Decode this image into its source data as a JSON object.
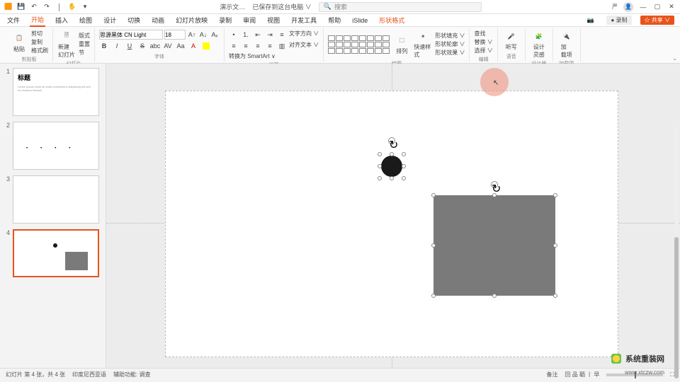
{
  "titlebar": {
    "doc_name": "演示文…",
    "autosave": "已保存到这台电脑 ∨",
    "search_placeholder": "搜索",
    "user_initial": "严"
  },
  "menu": {
    "tabs": [
      "文件",
      "开始",
      "插入",
      "绘图",
      "设计",
      "切换",
      "动画",
      "幻灯片放映",
      "录制",
      "审阅",
      "视图",
      "开发工具",
      "帮助",
      "iSlide",
      "形状格式"
    ],
    "active_index": 1,
    "record_btn": "● 录制",
    "share_btn": "☆ 共享 ∨",
    "camera_btn": "📷"
  },
  "ribbon": {
    "clipboard": {
      "paste": "粘贴",
      "cut": "剪切",
      "copy": "复制",
      "format_painter": "格式刷",
      "label": "剪贴板"
    },
    "slides": {
      "new_slide": "新建\n幻灯片",
      "layout": "版式",
      "reset": "重置",
      "section": "节",
      "label": "幻灯片"
    },
    "font": {
      "name": "思源黑体 CN Light",
      "size": "18",
      "label": "字体",
      "bold": "B",
      "italic": "I",
      "underline": "U",
      "strike": "S",
      "shadow": "abc",
      "spacing": "AV",
      "case": "Aa",
      "clear": "A"
    },
    "paragraph": {
      "dir": "文字方向 ∨",
      "align": "对齐文本 ∨",
      "smartart": "转换为 SmartArt ∨",
      "label": "段落"
    },
    "drawing": {
      "arrange": "排列",
      "quick": "快速样式",
      "fill": "形状填充 ∨",
      "outline": "形状轮廓 ∨",
      "effects": "形状效果 ∨",
      "label": "绘图"
    },
    "editing": {
      "find": "查找",
      "replace": "替换 ∨",
      "select": "选择 ∨",
      "label": "编辑"
    },
    "voice": {
      "dictate": "听写",
      "label": "语音"
    },
    "designer": {
      "btn": "设计\n灵感",
      "label": "设计器"
    },
    "addins": {
      "btn": "加\n载项",
      "label": "加载项"
    }
  },
  "thumbs": [
    {
      "n": "1",
      "title": "标题",
      "body": "…",
      "sel": false
    },
    {
      "n": "2",
      "dots": true,
      "sel": false
    },
    {
      "n": "3",
      "blank": true,
      "sel": false
    },
    {
      "n": "4",
      "mini_shapes": true,
      "sel": true
    }
  ],
  "status": {
    "slide_of": "幻灯片 第 4 张，共 4 张",
    "lang": "印度尼西亚语",
    "access": "辅助功能: 调查",
    "notes": "备注",
    "display": "回 品 聏 丨 早",
    "zoom": ""
  },
  "watermark": {
    "text": "系统重装网",
    "url": "www.xtczw.com"
  },
  "colors": {
    "accent": "#e8531b",
    "rect_fill": "#7a7a7a",
    "circle_fill": "#1a1a1a"
  }
}
